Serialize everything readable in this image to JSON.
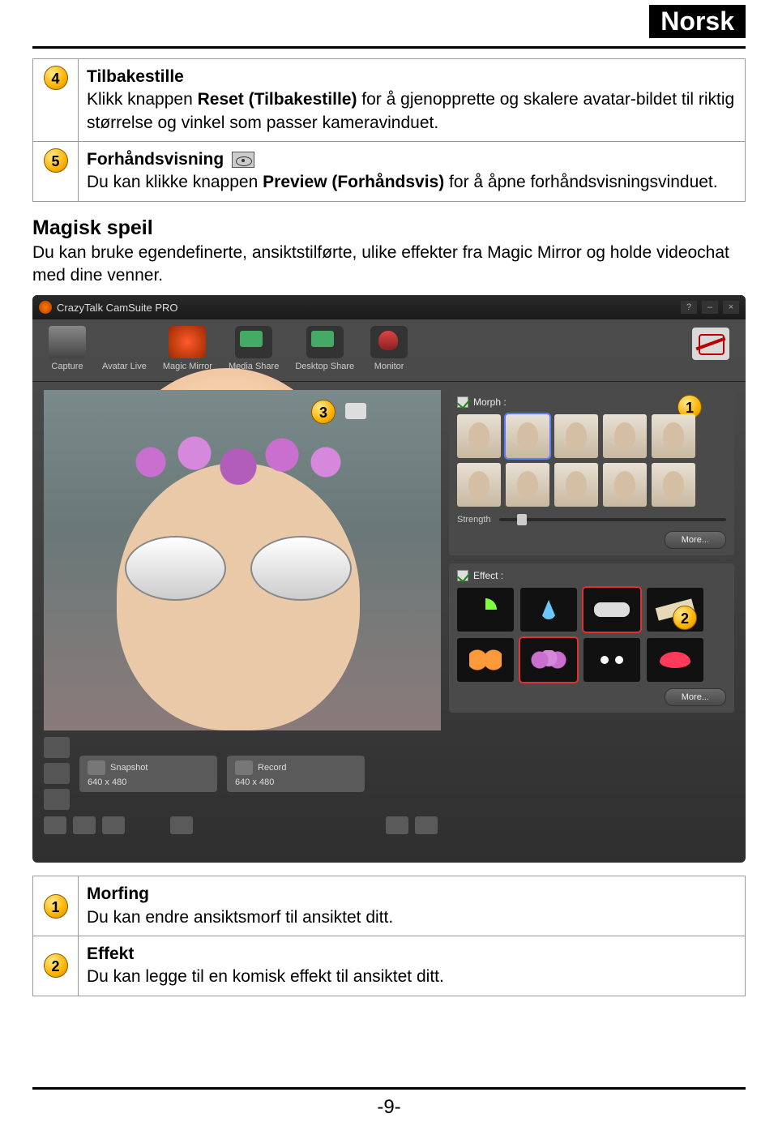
{
  "header": {
    "language": "Norsk"
  },
  "top_table": [
    {
      "num": "4",
      "title": "Tilbakestille",
      "text_before": "Klikk knappen ",
      "bold": "Reset (Tilbakestille)",
      "text_after": " for å gjenopprette og skalere avatar-bildet til riktig størrelse og vinkel som passer kameravinduet."
    },
    {
      "num": "5",
      "title": "Forhåndsvisning",
      "text_before": "Du kan klikke knappen ",
      "bold": "Preview (Forhåndsvis)",
      "text_after": " for å åpne forhåndsvisningsvinduet."
    }
  ],
  "section": {
    "title": "Magisk speil",
    "body": "Du kan bruke egendefinerte, ansiktstilførte, ulike effekter fra Magic Mirror og holde videochat med dine venner."
  },
  "app": {
    "title": "CrazyTalk CamSuite PRO",
    "toolbar": [
      "Capture",
      "Avatar Live",
      "Magic Mirror",
      "Media Share",
      "Desktop Share",
      "Monitor"
    ],
    "morph_label": "Morph :",
    "strength_label": "Strength",
    "more_label": "More...",
    "effect_label": "Effect :",
    "snapshot_label": "Snapshot",
    "snapshot_res": "640 x 480",
    "record_label": "Record",
    "record_res": "640 x 480",
    "callouts": {
      "c1": "1",
      "c2": "2",
      "c3": "3"
    }
  },
  "bottom_table": [
    {
      "num": "1",
      "title": "Morfing",
      "text": "Du kan endre ansiktsmorf til ansiktet ditt."
    },
    {
      "num": "2",
      "title": "Effekt",
      "text": "Du kan legge til en komisk effekt til ansiktet ditt."
    }
  ],
  "page_number": "-9-"
}
